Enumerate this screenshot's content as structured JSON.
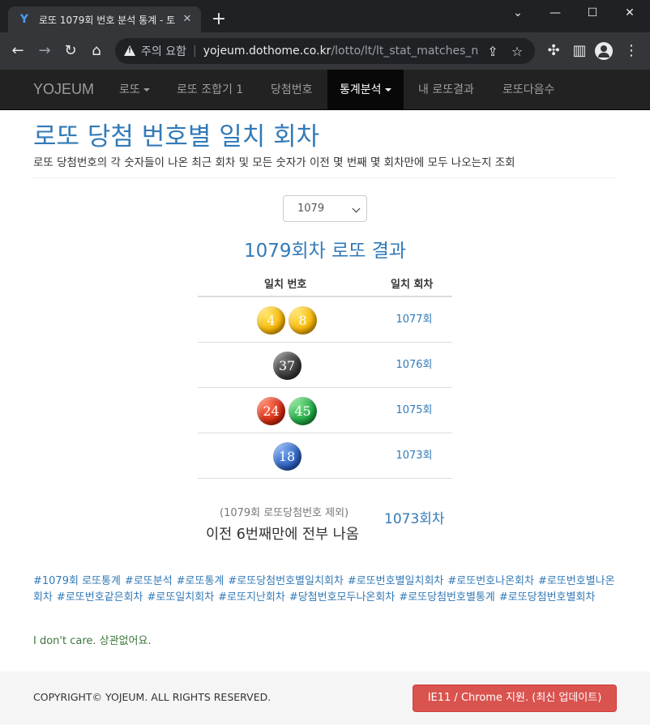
{
  "browser": {
    "tab_title": "로또 1079회 번호 분석 통계 - 토",
    "url_warning": "주의 요함",
    "url_host": "yojeum.dothome.co.kr",
    "url_path": "/lotto/lt/lt_stat_matches_num..."
  },
  "navbar": {
    "brand": "YOJEUM",
    "items": [
      {
        "label": "로또"
      },
      {
        "label": "로또 조합기 1"
      },
      {
        "label": "당첨번호"
      },
      {
        "label": "통계분석"
      },
      {
        "label": "내 로또결과"
      },
      {
        "label": "로또다음수"
      }
    ]
  },
  "page": {
    "title": "로또 당첨 번호별 일치 회차",
    "description": "로또 당첨번호의 각 숫자들이 나온 최근 회차 및 모든 숫자가 이전 몇 번째 몇 회차만에 모두 나오는지 조회",
    "selected_round": "1079",
    "result_title": "1079회차 로또 결과"
  },
  "table": {
    "headers": [
      "일치 번호",
      "일치 회차"
    ],
    "rows": [
      {
        "balls": [
          {
            "n": "4",
            "color": "#f7b500"
          },
          {
            "n": "8",
            "color": "#f7b500"
          }
        ],
        "round": "1077회"
      },
      {
        "balls": [
          {
            "n": "37",
            "color": "#3a3a3a"
          }
        ],
        "round": "1076회"
      },
      {
        "balls": [
          {
            "n": "24",
            "color": "#d52a10"
          },
          {
            "n": "45",
            "color": "#1fa843"
          }
        ],
        "round": "1075회"
      },
      {
        "balls": [
          {
            "n": "18",
            "color": "#2e63c2"
          }
        ],
        "round": "1073회"
      }
    ]
  },
  "summary": {
    "exclusion": "(1079회 로또당첨번호 제외)",
    "appear": "이전 6번째만에 전부 나옴",
    "last_round": "1073회차"
  },
  "tags": [
    "#1079회 로또통계",
    "#로또분석",
    "#로또통계",
    "#로또당첨번호별일치회차",
    "#로또번호별일치회차",
    "#로또번호나온회차",
    "#로또번호별나온회차",
    "#로또번호같은회차",
    "#로또일치회차",
    "#로또지난회차",
    "#당첨번호모두나온회차",
    "#로또당첨번호별통계",
    "#로또당첨번호별회차"
  ],
  "note": "I don't care. 상관없어요.",
  "footer": {
    "copyright": "COPYRIGHT© YOJEUM. ALL RIGHTS RESERVED.",
    "ie_button": "IE11 / Chrome 지원. (최신 업데이트)"
  }
}
